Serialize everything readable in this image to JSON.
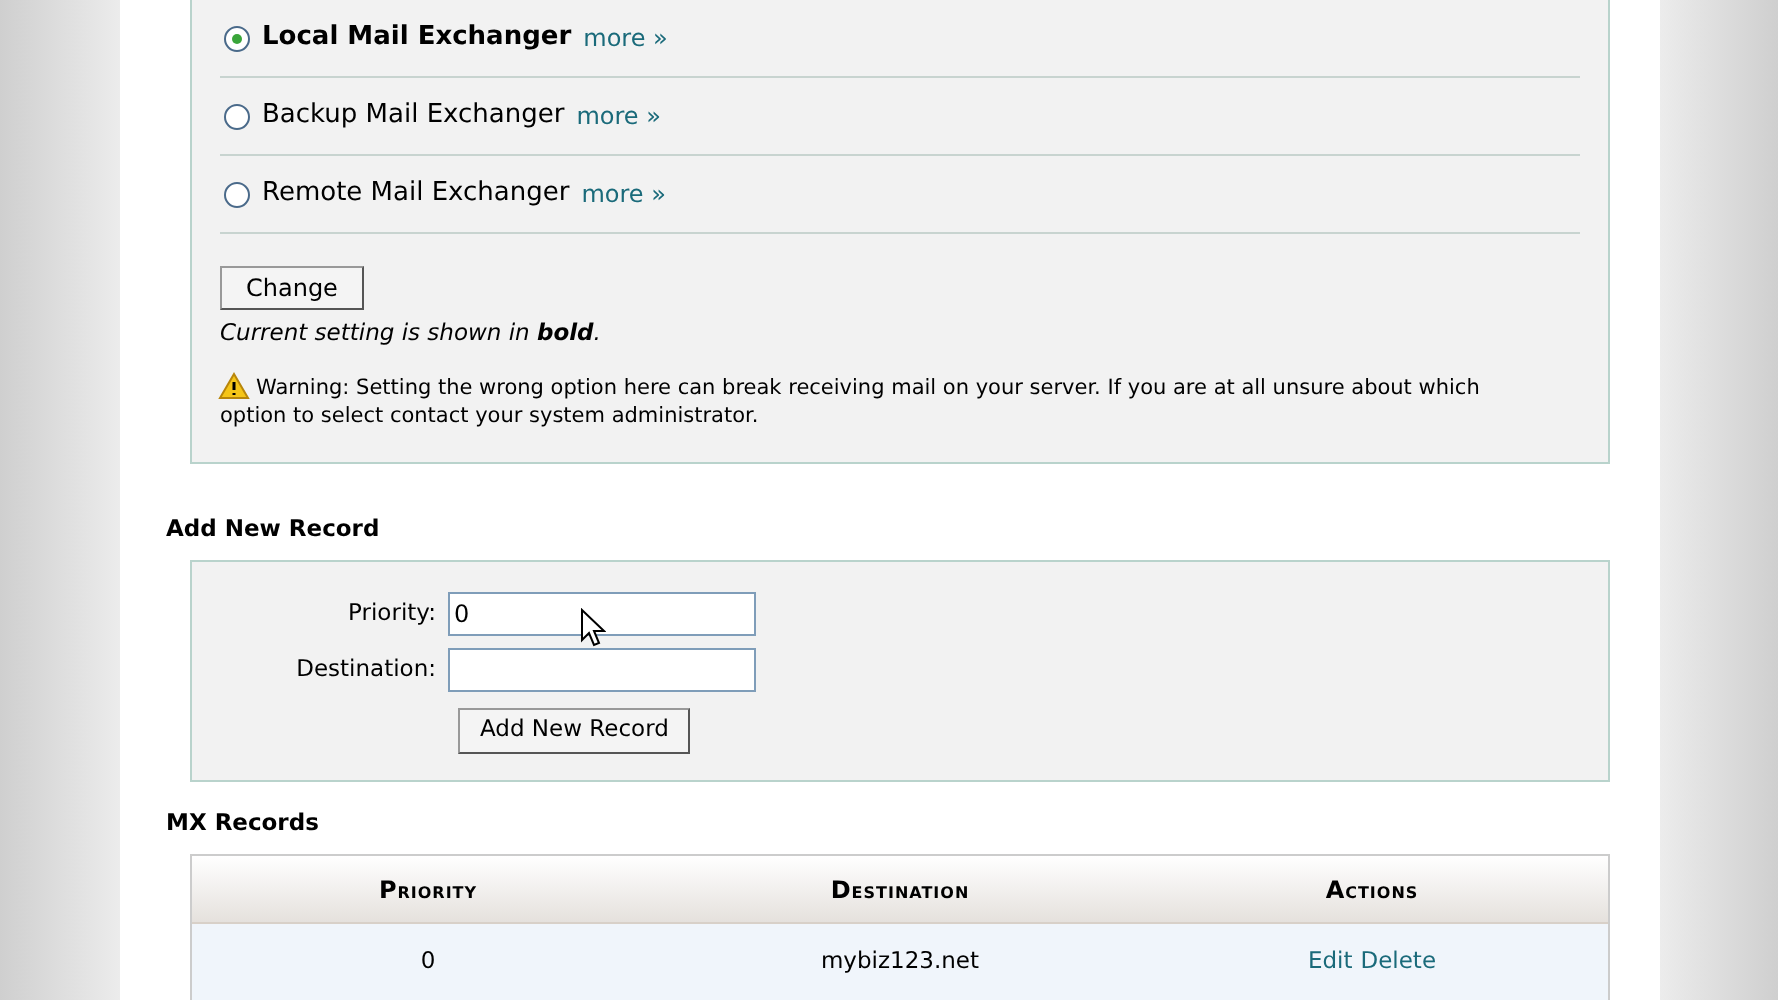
{
  "mail_exchanger": {
    "options": [
      {
        "label": "Local Mail Exchanger",
        "link": "more »",
        "selected": true
      },
      {
        "label": "Backup Mail Exchanger",
        "link": "more »",
        "selected": false
      },
      {
        "label": "Remote Mail Exchanger",
        "link": "more »",
        "selected": false
      }
    ],
    "button": "Change",
    "note": "Current setting is shown in **bold**.",
    "warning": "Warning: Setting the wrong option here can break receiving mail on your server. If you are at all unsure about which option to select contact your system administrator."
  },
  "add_record": {
    "heading": "Add New Record",
    "fields": [
      {
        "label": "Priority:",
        "value": "0"
      },
      {
        "label": "Destination:"
      }
    ],
    "button": "Add New Record"
  },
  "mx_records": {
    "heading": "MX Records",
    "columns": [
      "Priority",
      "Destination",
      "Actions"
    ],
    "rows": [
      {
        "priority": "0",
        "destination": "mybiz123.net",
        "actions": [
          "Edit",
          "Delete"
        ]
      }
    ]
  }
}
